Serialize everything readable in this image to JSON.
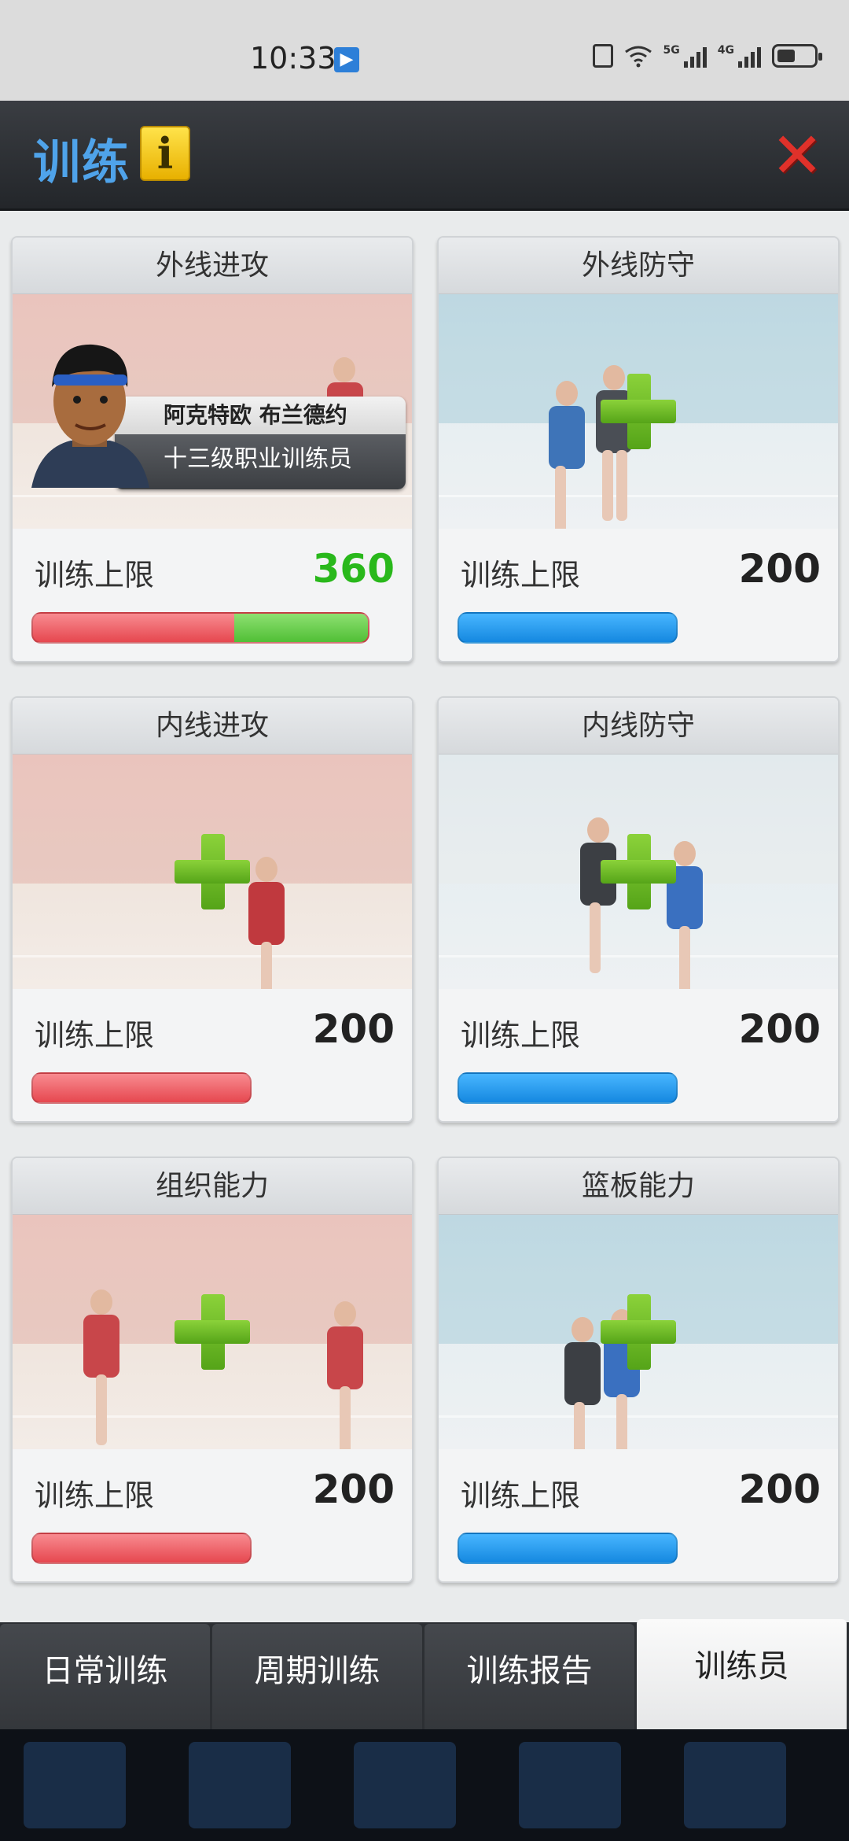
{
  "status_bar": {
    "time": "10:33",
    "notification_icon": "app-notification-icon",
    "sig1_label": "5G",
    "sig2_label": "4G"
  },
  "header": {
    "title": "训练",
    "info_label": "i",
    "close_glyph": "✕"
  },
  "cards": [
    {
      "title": "外线进攻",
      "limit_label": "训练上限",
      "limit_value": "360",
      "bar_color": "#e6474f",
      "value_color": "#29b81b",
      "progress_red_fraction": 0.6,
      "has_coach": true
    },
    {
      "title": "外线防守",
      "limit_label": "训练上限",
      "limit_value": "200",
      "bar_color": "#1588e0"
    },
    {
      "title": "内线进攻",
      "limit_label": "训练上限",
      "limit_value": "200",
      "bar_color": "#e6474f"
    },
    {
      "title": "内线防守",
      "limit_label": "训练上限",
      "limit_value": "200",
      "bar_color": "#1588e0"
    },
    {
      "title": "组织能力",
      "limit_label": "训练上限",
      "limit_value": "200",
      "bar_color": "#e6474f"
    },
    {
      "title": "篮板能力",
      "limit_label": "训练上限",
      "limit_value": "200",
      "bar_color": "#1588e0"
    }
  ],
  "coach": {
    "name": "阿克特欧 布兰德约",
    "level": "十三级职业训练员"
  },
  "tabs": [
    {
      "label": "日常训练",
      "active": false
    },
    {
      "label": "周期训练",
      "active": false
    },
    {
      "label": "训练报告",
      "active": false
    },
    {
      "label": "训练员",
      "active": true
    }
  ]
}
